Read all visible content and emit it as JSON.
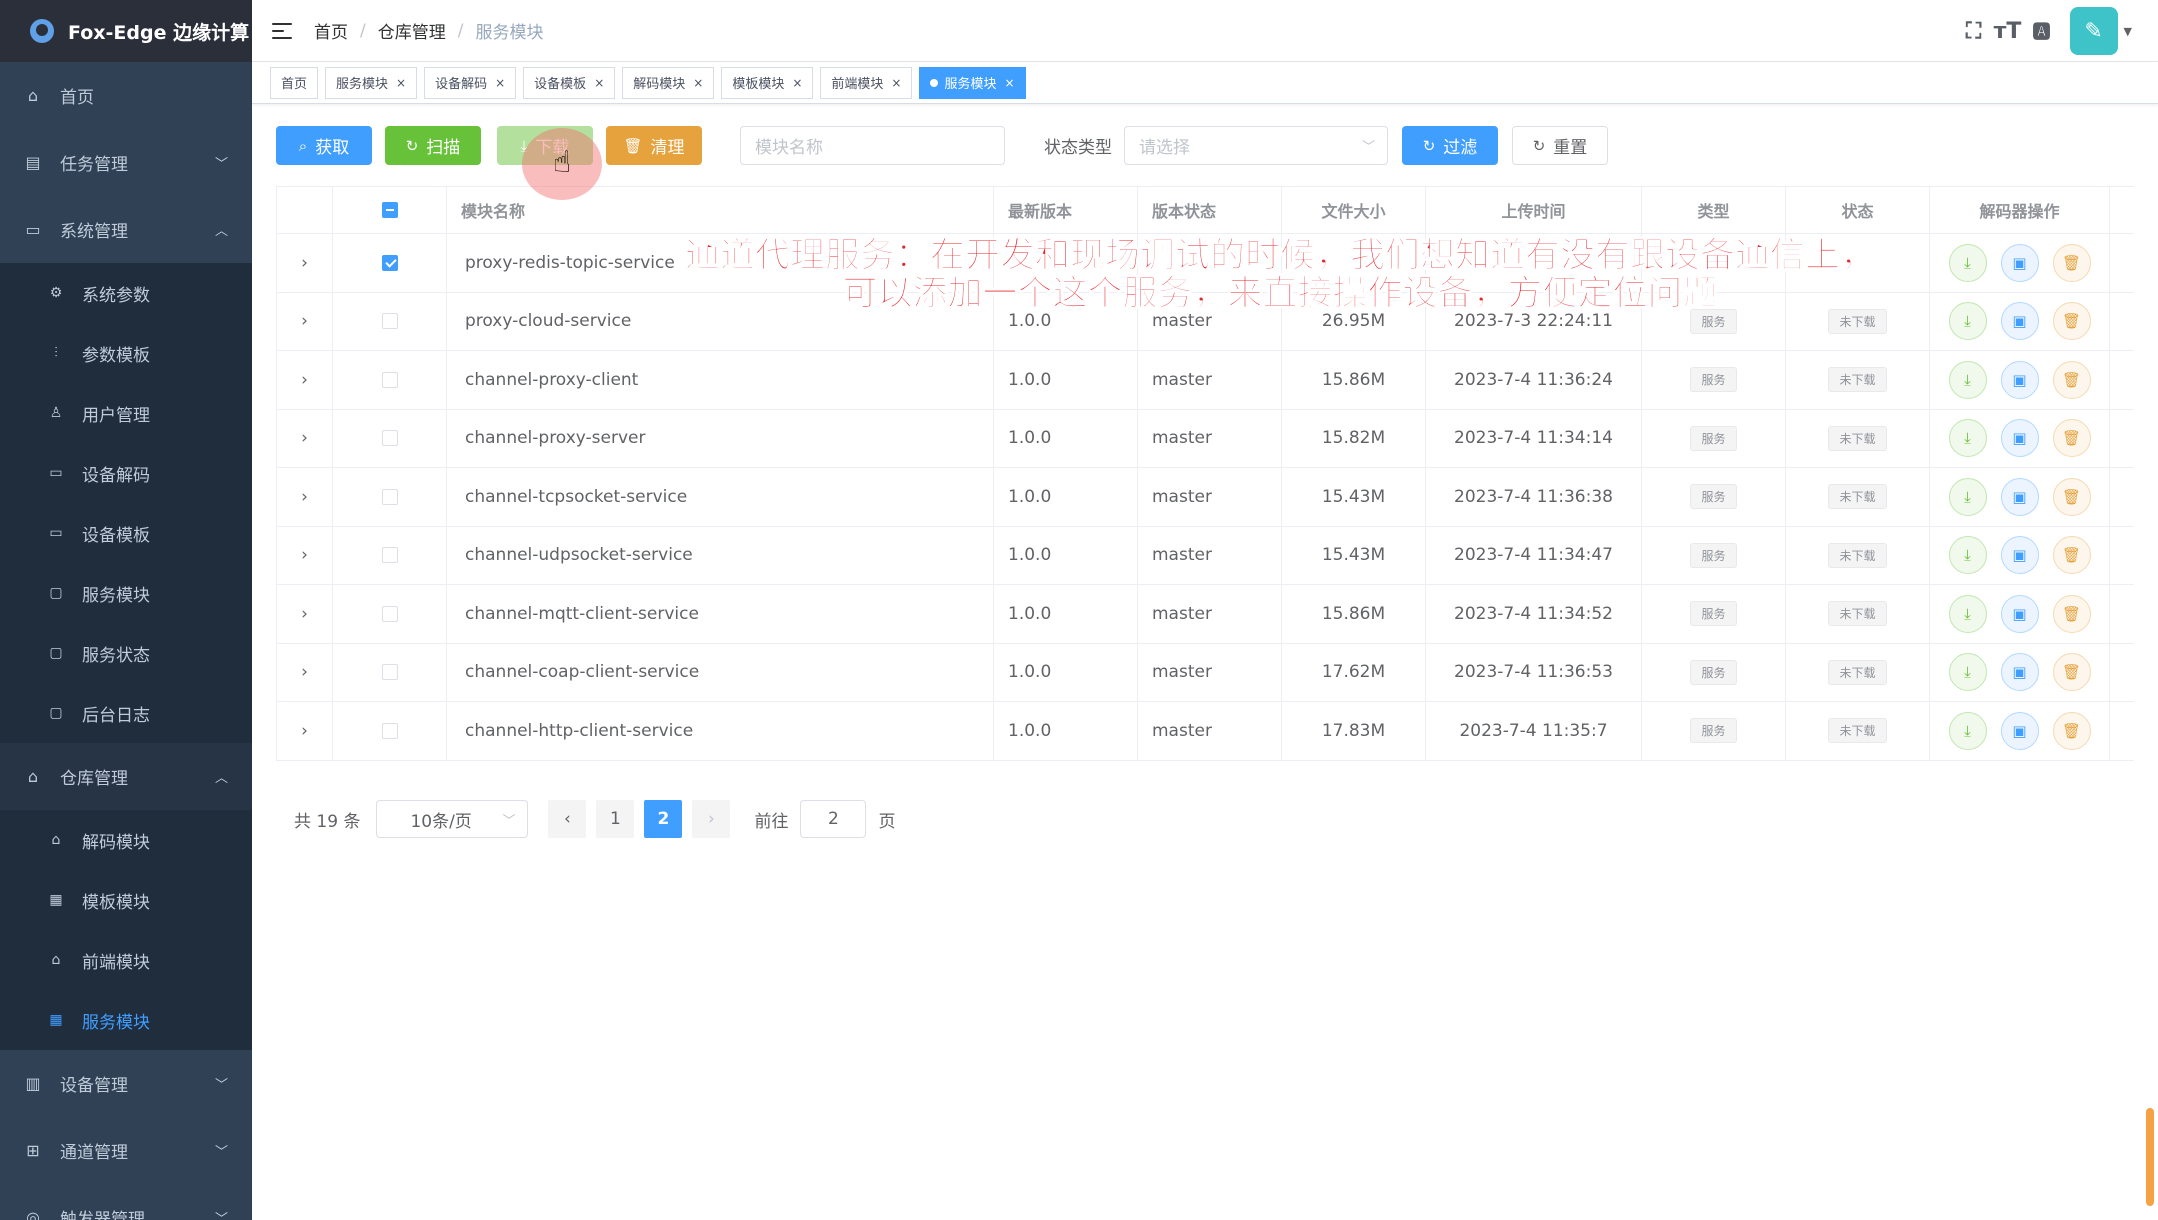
{
  "app": {
    "title": "Fox-Edge 边缘计算"
  },
  "sidebar": {
    "menu": [
      {
        "label": "首页",
        "icon": "home-icon"
      },
      {
        "label": "任务管理",
        "icon": "task-icon"
      },
      {
        "label": "系统管理",
        "icon": "system-icon"
      }
    ],
    "system_sub": [
      {
        "label": "系统参数",
        "icon": "gear-icon"
      },
      {
        "label": "参数模板",
        "icon": "sliders-icon"
      },
      {
        "label": "用户管理",
        "icon": "user-icon"
      },
      {
        "label": "设备解码",
        "icon": "keyboard-icon"
      },
      {
        "label": "设备模板",
        "icon": "keyboard-icon"
      },
      {
        "label": "服务模块",
        "icon": "document-icon"
      },
      {
        "label": "服务状态",
        "icon": "document-icon"
      },
      {
        "label": "后台日志",
        "icon": "document-icon"
      }
    ],
    "repo": {
      "label": "仓库管理",
      "icon": "warehouse-icon"
    },
    "repo_sub": [
      {
        "label": "解码模块",
        "icon": "warehouse-icon"
      },
      {
        "label": "模板模块",
        "icon": "form-icon"
      },
      {
        "label": "前端模块",
        "icon": "warehouse-icon"
      },
      {
        "label": "服务模块",
        "icon": "form-icon"
      }
    ],
    "bottom": [
      {
        "label": "设备管理",
        "icon": "device-icon"
      },
      {
        "label": "通道管理",
        "icon": "channel-icon"
      },
      {
        "label": "触发器管理",
        "icon": "trigger-icon"
      }
    ]
  },
  "breadcrumb": [
    "首页",
    "仓库管理",
    "服务模块"
  ],
  "tags": [
    {
      "label": "首页"
    },
    {
      "label": "服务模块"
    },
    {
      "label": "设备解码"
    },
    {
      "label": "设备模板"
    },
    {
      "label": "解码模块"
    },
    {
      "label": "模板模块"
    },
    {
      "label": "前端模块"
    },
    {
      "label": "服务模块"
    }
  ],
  "toolbar": {
    "fetch": "获取",
    "scan": "扫描",
    "download": "下载",
    "clear": "清理",
    "name_placeholder": "模块名称",
    "status_label": "状态类型",
    "status_placeholder": "请选择",
    "filter": "过滤",
    "reset": "重置"
  },
  "table": {
    "headers": {
      "name": "模块名称",
      "version": "最新版本",
      "status": "版本状态",
      "size": "文件大小",
      "time": "上传时间",
      "type": "类型",
      "state": "状态",
      "ops": "解码器操作"
    },
    "rows": [
      {
        "name": "proxy-redis-topic-service",
        "version": "",
        "status": "",
        "size": "",
        "time": "",
        "type": "",
        "state": "",
        "checked": true
      },
      {
        "name": "proxy-cloud-service",
        "version": "1.0.0",
        "status": "master",
        "size": "26.95M",
        "time": "2023-7-3 22:24:11",
        "type": "服务",
        "state": "未下载",
        "checked": false
      },
      {
        "name": "channel-proxy-client",
        "version": "1.0.0",
        "status": "master",
        "size": "15.86M",
        "time": "2023-7-4 11:36:24",
        "type": "服务",
        "state": "未下载",
        "checked": false
      },
      {
        "name": "channel-proxy-server",
        "version": "1.0.0",
        "status": "master",
        "size": "15.82M",
        "time": "2023-7-4 11:34:14",
        "type": "服务",
        "state": "未下载",
        "checked": false
      },
      {
        "name": "channel-tcpsocket-service",
        "version": "1.0.0",
        "status": "master",
        "size": "15.43M",
        "time": "2023-7-4 11:36:38",
        "type": "服务",
        "state": "未下载",
        "checked": false
      },
      {
        "name": "channel-udpsocket-service",
        "version": "1.0.0",
        "status": "master",
        "size": "15.43M",
        "time": "2023-7-4 11:34:47",
        "type": "服务",
        "state": "未下载",
        "checked": false
      },
      {
        "name": "channel-mqtt-client-service",
        "version": "1.0.0",
        "status": "master",
        "size": "15.86M",
        "time": "2023-7-4 11:34:52",
        "type": "服务",
        "state": "未下载",
        "checked": false
      },
      {
        "name": "channel-coap-client-service",
        "version": "1.0.0",
        "status": "master",
        "size": "17.62M",
        "time": "2023-7-4 11:36:53",
        "type": "服务",
        "state": "未下载",
        "checked": false
      },
      {
        "name": "channel-http-client-service",
        "version": "1.0.0",
        "status": "master",
        "size": "17.83M",
        "time": "2023-7-4 11:35:7",
        "type": "服务",
        "state": "未下载",
        "checked": false
      }
    ]
  },
  "subtitle": {
    "line1": "通道代理服务：在开发和现场调试的时候，我们想知道有没有跟设备通信上，",
    "line2": "可以添加一个这个服务，来直接操作设备，方便定位问题"
  },
  "pagination": {
    "total": "共 19 条",
    "page_size": "10条/页",
    "pages": [
      "1",
      "2"
    ],
    "current": "2",
    "goto_label": "前往",
    "goto_value": "2",
    "page_unit": "页"
  },
  "colors": {
    "primary": "#409eff",
    "sidebar_bg": "#304156",
    "subtitle": "#e8242b"
  }
}
